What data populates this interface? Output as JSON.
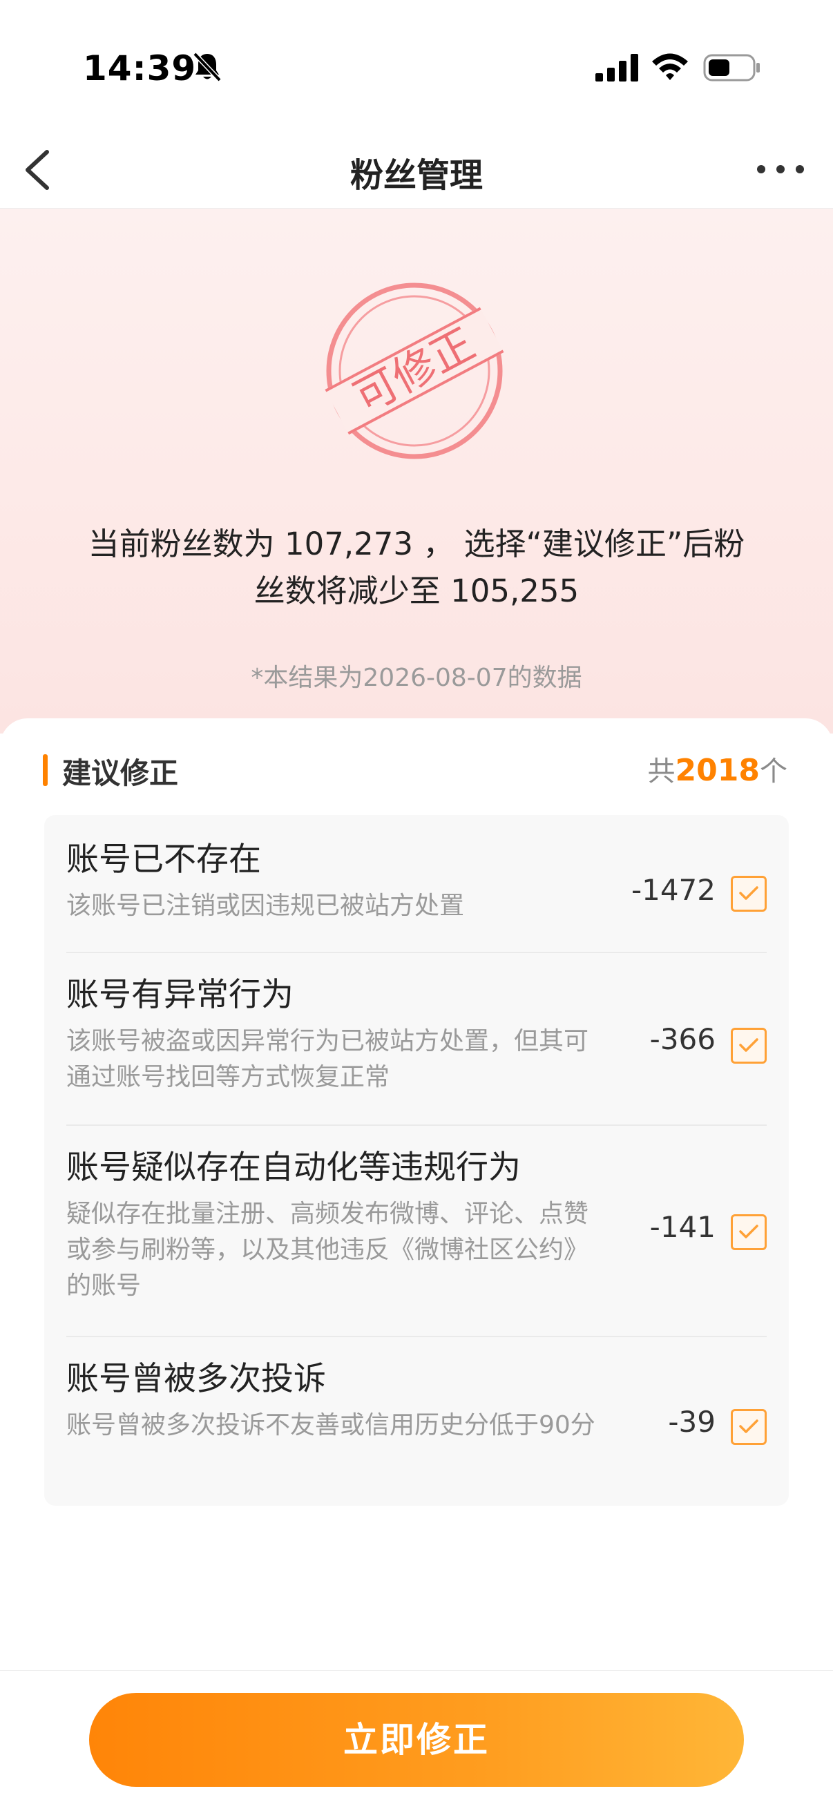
{
  "status_bar": {
    "time": "14:39"
  },
  "nav": {
    "title": "粉丝管理"
  },
  "hero": {
    "stamp_text": "可修正",
    "summary_line1": "当前粉丝数为 107,273 ， 选择“建议修正”后粉",
    "summary_line2": "丝数将减少至 105,255",
    "note": "*本结果为2026-08-07的数据"
  },
  "section": {
    "title": "建议修正",
    "total_prefix": "共",
    "total_count": "2018",
    "total_suffix": "个"
  },
  "items": [
    {
      "title": "账号已不存在",
      "desc": "该账号已注销或因违规已被站方处置",
      "count": "-1472",
      "checked": true
    },
    {
      "title": "账号有异常行为",
      "desc": "该账号被盗或因异常行为已被站方处置，但其可通过账号找回等方式恢复正常",
      "count": "-366",
      "checked": true
    },
    {
      "title": "账号疑似存在自动化等违规行为",
      "desc": "疑似存在批量注册、高频发布微博、评论、点赞或参与刷粉等，以及其他违反《微博社区公约》的账号",
      "count": "-141",
      "checked": true
    },
    {
      "title": "账号曾被多次投诉",
      "desc": "账号曾被多次投诉不友善或信用历史分低于90分",
      "count": "-39",
      "checked": true
    }
  ],
  "action": {
    "label": "立即修正"
  },
  "colors": {
    "accent": "#ff8200",
    "stamp": "#f27c80"
  }
}
